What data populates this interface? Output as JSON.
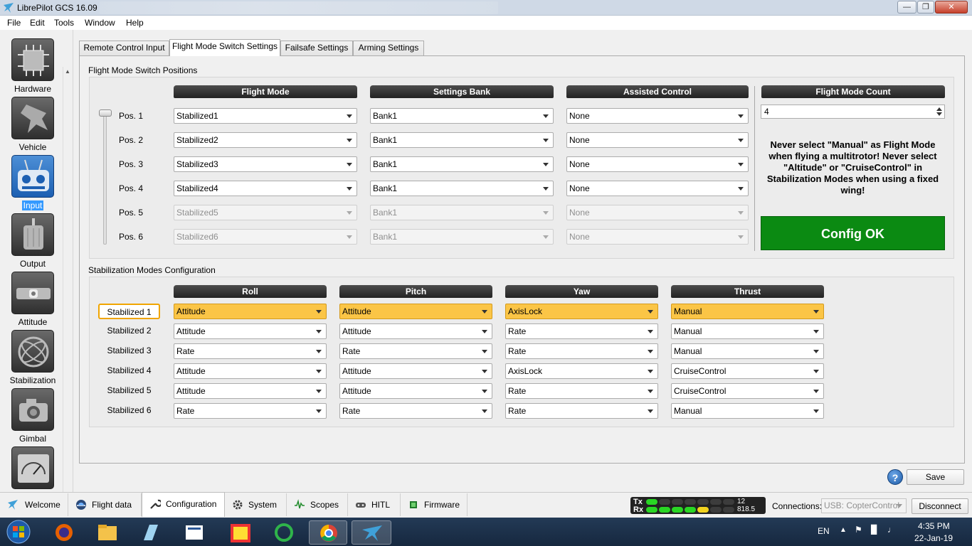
{
  "window": {
    "title": "LibrePilot GCS 16.09"
  },
  "menu": [
    "File",
    "Edit",
    "Tools",
    "Window",
    "Help"
  ],
  "sidebar": [
    {
      "label": "Hardware",
      "icon": "hardware-chip-icon"
    },
    {
      "label": "Vehicle",
      "icon": "vehicle-plane-icon"
    },
    {
      "label": "Input",
      "icon": "radio-transmitter-icon",
      "selected": true
    },
    {
      "label": "Output",
      "icon": "motor-icon"
    },
    {
      "label": "Attitude",
      "icon": "level-icon"
    },
    {
      "label": "Stabilization",
      "icon": "gyro-icon"
    },
    {
      "label": "Gimbal",
      "icon": "camera-icon"
    },
    {
      "label": "",
      "icon": "gauge-icon"
    }
  ],
  "tabs": [
    "Remote Control Input",
    "Flight Mode Switch Settings",
    "Failsafe Settings",
    "Arming Settings"
  ],
  "active_tab": 1,
  "flight_mode": {
    "group_title": "Flight Mode Switch Positions",
    "headers": {
      "flight_mode": "Flight Mode",
      "settings_bank": "Settings Bank",
      "assisted_control": "Assisted Control",
      "count": "Flight Mode Count"
    },
    "positions": [
      {
        "label": "Pos. 1",
        "mode": "Stabilized1",
        "bank": "Bank1",
        "assist": "None",
        "enabled": true
      },
      {
        "label": "Pos. 2",
        "mode": "Stabilized2",
        "bank": "Bank1",
        "assist": "None",
        "enabled": true
      },
      {
        "label": "Pos. 3",
        "mode": "Stabilized3",
        "bank": "Bank1",
        "assist": "None",
        "enabled": true
      },
      {
        "label": "Pos. 4",
        "mode": "Stabilized4",
        "bank": "Bank1",
        "assist": "None",
        "enabled": true
      },
      {
        "label": "Pos. 5",
        "mode": "Stabilized5",
        "bank": "Bank1",
        "assist": "None",
        "enabled": false
      },
      {
        "label": "Pos. 6",
        "mode": "Stabilized6",
        "bank": "Bank1",
        "assist": "None",
        "enabled": false
      }
    ],
    "count_value": "4",
    "warning": "Never select \"Manual\" as Flight Mode when flying a multitrotor! Never select \"Altitude\" or \"CruiseControl\" in Stabilization Modes when using a fixed wing!",
    "status": "Config OK"
  },
  "stabilization": {
    "group_title": "Stabilization Modes Configuration",
    "headers": [
      "Roll",
      "Pitch",
      "Yaw",
      "Thrust"
    ],
    "rows": [
      {
        "label": "Stabilized 1",
        "values": [
          "Attitude",
          "Attitude",
          "AxisLock",
          "Manual"
        ],
        "highlight": true
      },
      {
        "label": "Stabilized 2",
        "values": [
          "Attitude",
          "Attitude",
          "Rate",
          "Manual"
        ]
      },
      {
        "label": "Stabilized 3",
        "values": [
          "Rate",
          "Rate",
          "Rate",
          "Manual"
        ]
      },
      {
        "label": "Stabilized 4",
        "values": [
          "Attitude",
          "Attitude",
          "AxisLock",
          "CruiseControl"
        ]
      },
      {
        "label": "Stabilized 5",
        "values": [
          "Attitude",
          "Attitude",
          "Rate",
          "CruiseControl"
        ]
      },
      {
        "label": "Stabilized 6",
        "values": [
          "Rate",
          "Rate",
          "Rate",
          "Manual"
        ]
      }
    ]
  },
  "buttons": {
    "help": "?",
    "save": "Save",
    "disconnect": "Disconnect"
  },
  "bottom_tabs": [
    {
      "label": "Welcome",
      "icon": "welcome-icon"
    },
    {
      "label": "Flight data",
      "icon": "flight-data-icon"
    },
    {
      "label": "Configuration",
      "icon": "wrench-icon",
      "active": true
    },
    {
      "label": "System",
      "icon": "gear-icon"
    },
    {
      "label": "Scopes",
      "icon": "scope-icon"
    },
    {
      "label": "HITL",
      "icon": "gamepad-icon"
    },
    {
      "label": "Firmware",
      "icon": "chip-icon"
    }
  ],
  "telemetry": {
    "tx_label": "Tx",
    "rx_label": "Rx",
    "tx_value": "12",
    "rx_value": "818.5",
    "tx_leds": 1,
    "rx_leds_green": 4,
    "rx_leds_yellow": 1
  },
  "connections": {
    "label": "Connections:",
    "value": "USB: CopterControl"
  },
  "taskbar": {
    "lang": "EN",
    "time": "4:35 PM",
    "date": "22-Jan-19"
  },
  "colors": {
    "highlight": "#fbc546",
    "config_ok": "#0b8a12",
    "header": "#2e2e2e",
    "selection": "#3399ff"
  }
}
